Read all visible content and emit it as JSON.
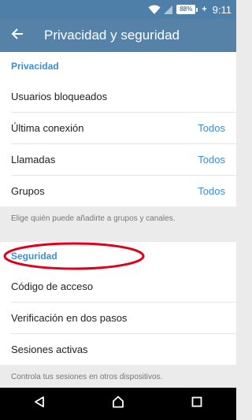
{
  "status_bar": {
    "battery": "88%",
    "time": "9:11",
    "icons": [
      "wifi-icon",
      "cellular-signal-icon",
      "battery-icon",
      "charging-icon"
    ]
  },
  "app_bar": {
    "title": "Privacidad y seguridad",
    "back_icon": "arrow-back-icon"
  },
  "privacy": {
    "header": "Privacidad",
    "items": [
      {
        "label": "Usuarios bloqueados",
        "value": ""
      },
      {
        "label": "Última conexión",
        "value": "Todos"
      },
      {
        "label": "Llamadas",
        "value": "Todos"
      },
      {
        "label": "Grupos",
        "value": "Todos"
      }
    ],
    "note": "Elige quién puede añadirte a grupos y canales."
  },
  "security": {
    "header": "Seguridad",
    "items": [
      {
        "label": "Código de acceso"
      },
      {
        "label": "Verificación en dos pasos"
      },
      {
        "label": "Sesiones activas"
      }
    ],
    "note": "Controla tus sesiones en otros dispositivos."
  },
  "colors": {
    "app_bar": "#5682a8",
    "status_bar": "#4e7fa9",
    "accent": "#3a8ed2",
    "highlight": "#e0001b"
  },
  "nav_bar": {
    "icons": [
      "back-triangle-icon",
      "home-circle-icon",
      "recents-square-icon"
    ]
  }
}
